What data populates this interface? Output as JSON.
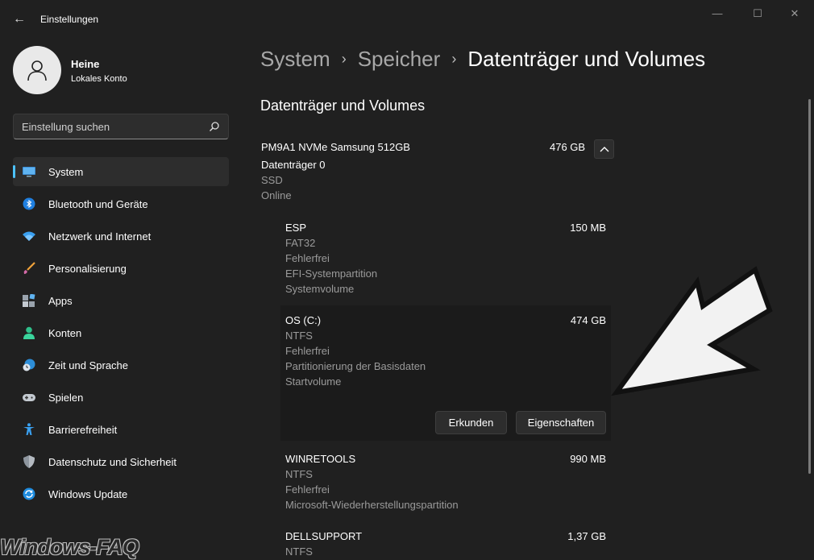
{
  "window": {
    "title": "Einstellungen",
    "back_glyph": "←",
    "controls": {
      "minimize": "—",
      "maximize": "☐",
      "close": "✕"
    }
  },
  "profile": {
    "name": "Heine",
    "account_type": "Lokales Konto"
  },
  "search": {
    "placeholder": "Einstellung suchen",
    "icon": "search-icon"
  },
  "sidebar": {
    "items": [
      {
        "label": "System",
        "icon": "system-monitor-icon",
        "selected": true
      },
      {
        "label": "Bluetooth und Geräte",
        "icon": "bluetooth-icon"
      },
      {
        "label": "Netzwerk und Internet",
        "icon": "wifi-icon"
      },
      {
        "label": "Personalisierung",
        "icon": "paintbrush-icon"
      },
      {
        "label": "Apps",
        "icon": "apps-icon"
      },
      {
        "label": "Konten",
        "icon": "person-icon"
      },
      {
        "label": "Zeit und Sprache",
        "icon": "clock-globe-icon"
      },
      {
        "label": "Spielen",
        "icon": "gamepad-icon"
      },
      {
        "label": "Barrierefreiheit",
        "icon": "accessibility-icon"
      },
      {
        "label": "Datenschutz und Sicherheit",
        "icon": "shield-icon"
      },
      {
        "label": "Windows Update",
        "icon": "update-icon"
      }
    ]
  },
  "breadcrumb": {
    "items": [
      "System",
      "Speicher"
    ],
    "current": "Datenträger und Volumes",
    "separator": "›"
  },
  "section_title": "Datenträger und Volumes",
  "disk": {
    "name": "PM9A1 NVMe Samsung 512GB",
    "size": "476 GB",
    "label": "Datenträger 0",
    "type": "SSD",
    "status": "Online",
    "toggle_icon": "chevron-up-icon"
  },
  "volumes": [
    {
      "name": "ESP",
      "size": "150 MB",
      "lines": [
        "FAT32",
        "Fehlerfrei",
        "EFI-Systempartition",
        "Systemvolume"
      ]
    },
    {
      "name": "OS (C:)",
      "size": "474 GB",
      "lines": [
        "NTFS",
        "Fehlerfrei",
        "Partitionierung der Basisdaten",
        "Startvolume"
      ],
      "expanded": true,
      "buttons": {
        "explore": "Erkunden",
        "properties": "Eigenschaften"
      }
    },
    {
      "name": "WINRETOOLS",
      "size": "990 MB",
      "lines": [
        "NTFS",
        "Fehlerfrei",
        "Microsoft-Wiederherstellungspartition"
      ]
    },
    {
      "name": "DELLSUPPORT",
      "size": "1,37 GB",
      "lines": [
        "NTFS"
      ]
    }
  ],
  "watermark": "Windows-FAQ",
  "colors": {
    "background": "#202020",
    "accent": "#4cc2ff",
    "selected_bg": "#2d2d2d",
    "secondary_text": "#9a9a9a"
  }
}
